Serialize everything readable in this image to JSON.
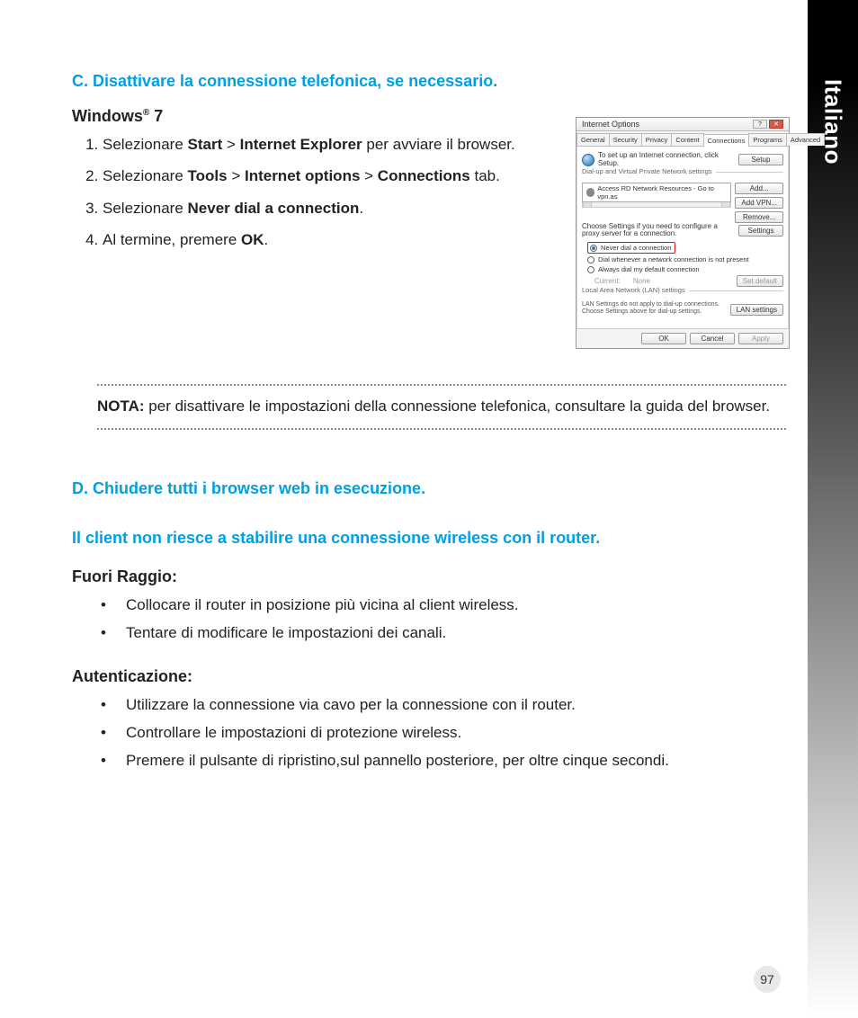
{
  "side_label": "Italiano",
  "page_number": "97",
  "sectionC": {
    "heading": "C.   Disattivare la connessione telefonica, se necessario.",
    "os": "Windows® 7",
    "step1_a": "Selezionare ",
    "step1_b": "Start",
    "step1_c": " > ",
    "step1_d": "Internet Explorer",
    "step1_e": " per avviare il browser.",
    "step2_a": "Selezionare ",
    "step2_b": "Tools",
    "step2_c": " > ",
    "step2_d": "Internet options",
    "step2_e": " > ",
    "step2_f": "Connections",
    "step2_g": " tab.",
    "step3_a": "Selezionare ",
    "step3_b": "Never dial a connection",
    "step3_c": ".",
    "step4_a": "Al termine, premere ",
    "step4_b": "OK",
    "step4_c": "."
  },
  "note": {
    "label": "NOTA:",
    "text": "  per disattivare le impostazioni della connessione telefonica, consultare la guida del browser."
  },
  "sectionD": {
    "heading": "D.   Chiudere tutti i browser web in esecuzione."
  },
  "issue": {
    "heading": "Il client non riesce a stabilire una connessione wireless con il router.",
    "fuori_h": "Fuori Raggio:",
    "fuori_b1": "Collocare il router in posizione più vicina al client wireless.",
    "fuori_b2": "Tentare di modificare le impostazioni dei canali.",
    "auth_h": "Autenticazione:",
    "auth_b1": " Utilizzare la connessione via cavo per la connessione con il router.",
    "auth_b2": "Controllare le impostazioni di protezione wireless.",
    "auth_b3": "Premere il pulsante di ripristino,sul pannello posteriore, per oltre cinque secondi."
  },
  "shot": {
    "title": "Internet Options",
    "tabs": [
      "General",
      "Security",
      "Privacy",
      "Content",
      "Connections",
      "Programs",
      "Advanced"
    ],
    "setup_text": "To set up an Internet connection, click Setup.",
    "setup_btn": "Setup",
    "group1": "Dial-up and Virtual Private Network settings",
    "list_item": "Access RD Network Resources - Go to vpn.as",
    "btn_add": "Add...",
    "btn_addvpn": "Add VPN...",
    "btn_remove": "Remove...",
    "proxy_text": "Choose Settings if you need to configure a proxy server for a connection.",
    "btn_settings": "Settings",
    "r1": "Never dial a connection",
    "r2": "Dial whenever a network connection is not present",
    "r3": "Always dial my default connection",
    "current": "Current:",
    "none": "None",
    "btn_setdef": "Set default",
    "group2": "Local Area Network (LAN) settings",
    "lan_text": "LAN Settings do not apply to dial-up connections. Choose Settings above for dial-up settings.",
    "btn_lan": "LAN settings",
    "ok": "OK",
    "cancel": "Cancel",
    "apply": "Apply"
  }
}
